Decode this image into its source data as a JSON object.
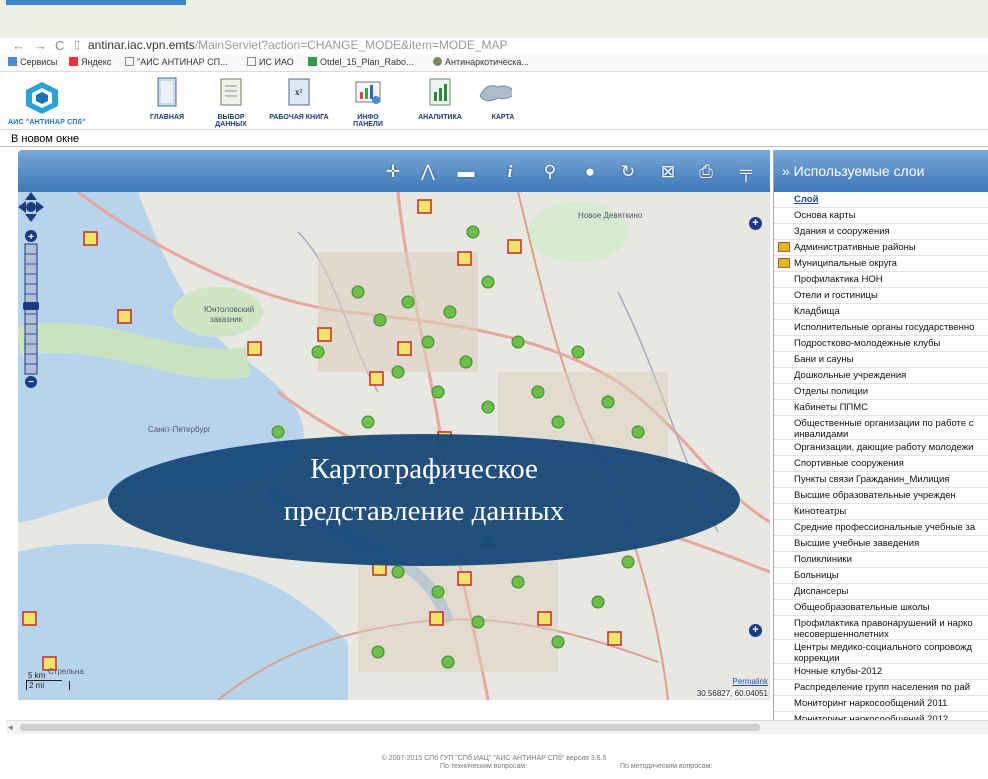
{
  "browser": {
    "address_url_host": "antinar.iac.vpn.emts",
    "address_url_path": "/MainServlet?action=CHANGE_MODE&item=MODE_MAP",
    "bookmarks": [
      "Сервисы",
      "Яндекс",
      "\"АИС АНТИНАР СП...",
      "ИС ИАО",
      "Otdel_15_Plan_Rabo...",
      "Антинаркотическа..."
    ]
  },
  "app": {
    "brand_name": "АИС \"АНТИНАР СПб\"",
    "nav": [
      "ГЛАВНАЯ",
      "ВЫБОР ДАННЫХ",
      "РАБОЧАЯ КНИГА",
      "ИНФО ПАНЕЛИ",
      "АНАЛИТИКА",
      "КАРТА"
    ],
    "sub_bar": "В новом окне"
  },
  "map": {
    "tools": [
      "pan-icon",
      "measure-icon",
      "ruler-icon",
      "info-icon",
      "search-icon",
      "globe-icon",
      "refresh-icon",
      "zoom-box-icon",
      "print-icon",
      "settings-icon"
    ],
    "scale_km": "5 km",
    "scale_mi": "2 mi",
    "permalink": "Permalink",
    "coordinates": "30.56827, 60.04051"
  },
  "layers": {
    "header": "» Используемые слои",
    "column_title": "Слой",
    "items": [
      {
        "label": "Основа карты",
        "icon": false,
        "wrap": false
      },
      {
        "label": "Здания и сооружения",
        "icon": false,
        "wrap": false
      },
      {
        "label": "Административные районы",
        "icon": true,
        "wrap": false
      },
      {
        "label": "Муниципальные округа",
        "icon": true,
        "wrap": false
      },
      {
        "label": "Профилактика НОН",
        "icon": false,
        "wrap": false
      },
      {
        "label": "Отели и гостиницы",
        "icon": false,
        "wrap": false
      },
      {
        "label": "Кладбища",
        "icon": false,
        "wrap": false
      },
      {
        "label": "Исполнительные органы государственно",
        "icon": false,
        "wrap": false
      },
      {
        "label": "Подростково-молодежные клубы",
        "icon": false,
        "wrap": false
      },
      {
        "label": "Бани и сауны",
        "icon": false,
        "wrap": false
      },
      {
        "label": "Дошкольные учреждения",
        "icon": false,
        "wrap": false
      },
      {
        "label": "Отделы полиции",
        "icon": false,
        "wrap": false
      },
      {
        "label": "Кабинеты ППМС",
        "icon": false,
        "wrap": false
      },
      {
        "label": "Общественные организации по работе с инвалидами",
        "icon": false,
        "wrap": true
      },
      {
        "label": "Организации, дающие работу молодежи",
        "icon": false,
        "wrap": false
      },
      {
        "label": "Спортивные сооружения",
        "icon": false,
        "wrap": false
      },
      {
        "label": "Пункты связи Гражданин_Милиция",
        "icon": false,
        "wrap": false
      },
      {
        "label": "Высшие образовательные учрежден",
        "icon": false,
        "wrap": false
      },
      {
        "label": "Кинотеатры",
        "icon": false,
        "wrap": false
      },
      {
        "label": "Средние профессиональные учебные за",
        "icon": false,
        "wrap": false
      },
      {
        "label": "Высшие учебные заведения",
        "icon": false,
        "wrap": false
      },
      {
        "label": "Поликлиники",
        "icon": false,
        "wrap": false
      },
      {
        "label": "Больницы",
        "icon": false,
        "wrap": false
      },
      {
        "label": "Диспансеры",
        "icon": false,
        "wrap": false
      },
      {
        "label": "Общеобразовательные школы",
        "icon": false,
        "wrap": false
      },
      {
        "label": "Профилактика правонарушений и нарко несовершеннолетних",
        "icon": false,
        "wrap": true
      },
      {
        "label": "Центры медико-социального сопровожд коррекции",
        "icon": false,
        "wrap": true
      },
      {
        "label": "Ночные клубы-2012",
        "icon": false,
        "wrap": false
      },
      {
        "label": "Распределение групп населения по рай",
        "icon": false,
        "wrap": false
      },
      {
        "label": "Мониторинг наркосообщений 2011",
        "icon": false,
        "wrap": false
      },
      {
        "label": "Мониторинг наркосообщений 2012",
        "icon": false,
        "wrap": false
      }
    ]
  },
  "footer": {
    "copyright": "© 2007-2015 СПб ГУП \"СПб ИАЦ\" \"АИС АНТИНАР СПб\" версия 3.6.5",
    "tech": "По техническим вопросам:",
    "method": "По методическим вопросам:"
  },
  "overlay": {
    "line1": "Картографическое",
    "line2": "представление данных"
  }
}
